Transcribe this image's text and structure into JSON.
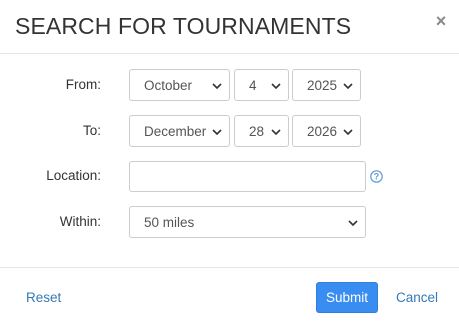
{
  "dialog": {
    "title": "SEARCH FOR TOURNAMENTS",
    "close_label": "×"
  },
  "form": {
    "from": {
      "label": "From:",
      "month": "October",
      "day": "4",
      "year": "2025"
    },
    "to": {
      "label": "To:",
      "month": "December",
      "day": "28",
      "year": "2026"
    },
    "location": {
      "label": "Location:",
      "value": "",
      "placeholder": "",
      "help_icon": "question-circle-icon"
    },
    "within": {
      "label": "Within:",
      "value": "50 miles"
    }
  },
  "footer": {
    "reset_label": "Reset",
    "submit_label": "Submit",
    "cancel_label": "Cancel"
  },
  "colors": {
    "primary": "#3a8df0",
    "link": "#337ab7",
    "help_icon": "#5b9bd5"
  }
}
